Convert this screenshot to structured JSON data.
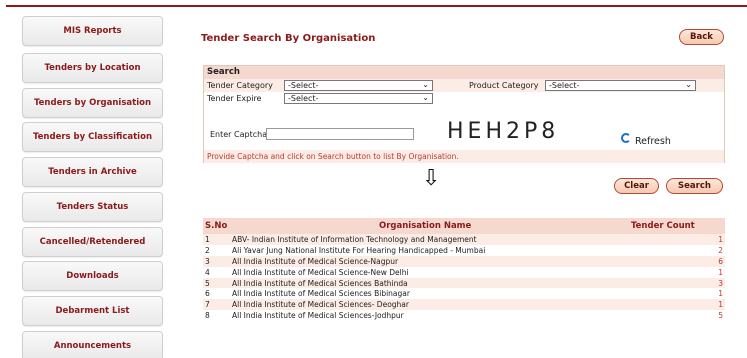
{
  "sidebar": {
    "items": [
      {
        "label": "MIS Reports"
      },
      {
        "label": "Tenders by Location"
      },
      {
        "label": "Tenders by Organisation"
      },
      {
        "label": "Tenders by Classification"
      },
      {
        "label": "Tenders in Archive"
      },
      {
        "label": "Tenders Status"
      },
      {
        "label": "Cancelled/Retendered"
      },
      {
        "label": "Downloads"
      },
      {
        "label": "Debarment List"
      },
      {
        "label": "Announcements"
      }
    ]
  },
  "main": {
    "title": "Tender Search By Organisation",
    "back_label": "Back",
    "search": {
      "heading": "Search",
      "tender_category_label": "Tender Category",
      "tender_category_value": "-Select-",
      "product_category_label": "Product Category",
      "product_category_value": "-Select-",
      "tender_expire_label": "Tender Expire",
      "tender_expire_value": "-Select-",
      "captcha_label": "Enter Captcha",
      "captcha_value": "",
      "captcha_text": "HEH2P8",
      "refresh_label": "Refresh",
      "hint": "Provide Captcha and click on Search button to list By Organisation."
    },
    "clear_label": "Clear",
    "search_label": "Search",
    "table": {
      "headers": {
        "sno": "S.No",
        "name": "Organisation Name",
        "count": "Tender Count"
      },
      "rows": [
        {
          "sno": "1",
          "name": "ABV- Indian Institute of Information Technology and Management",
          "count": "1"
        },
        {
          "sno": "2",
          "name": "Ali Yavar Jung National Institute For Hearing Handicapped - Mumbai",
          "count": "2"
        },
        {
          "sno": "3",
          "name": "All India Institute of Medical Science-Nagpur",
          "count": "6"
        },
        {
          "sno": "4",
          "name": "All India Institute of Medical Science-New Delhi",
          "count": "1"
        },
        {
          "sno": "5",
          "name": "All India Institute of Medical Sciences Bathinda",
          "count": "3"
        },
        {
          "sno": "6",
          "name": "All India Institute of Medical Sciences Bibinagar",
          "count": "1"
        },
        {
          "sno": "7",
          "name": "All India Institute of Medical Sciences- Deoghar",
          "count": "1"
        },
        {
          "sno": "8",
          "name": "All India Institute of Medical Sciences-Jodhpur",
          "count": "5"
        }
      ]
    }
  }
}
